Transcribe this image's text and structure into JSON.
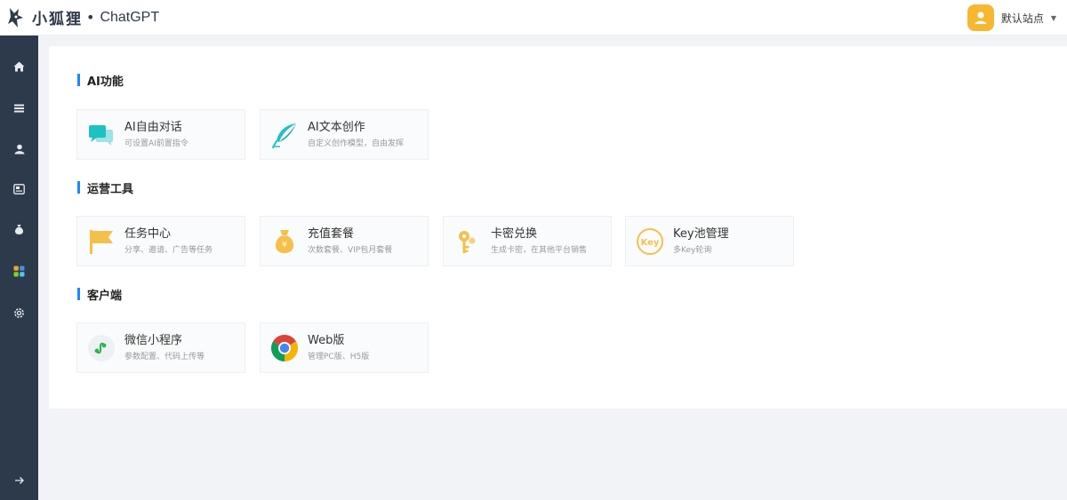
{
  "header": {
    "brand_cn": "小狐狸",
    "brand_dot": "•",
    "brand_en": "ChatGPT",
    "user_label": "默认站点",
    "caret": "▼"
  },
  "sidebar": {
    "items": [
      {
        "icon": "home-icon"
      },
      {
        "icon": "list-icon"
      },
      {
        "icon": "user-icon"
      },
      {
        "icon": "media-icon"
      },
      {
        "icon": "money-bag-icon"
      },
      {
        "icon": "apps-icon",
        "active": true
      },
      {
        "icon": "gear-icon"
      }
    ],
    "collapse_icon": "arrow-right-icon"
  },
  "sections": [
    {
      "title": "AI功能",
      "cards": [
        {
          "title": "AI自由对话",
          "desc": "可设置AI前置指令",
          "icon": "chat-bubbles-icon"
        },
        {
          "title": "AI文本创作",
          "desc": "自定义创作模型，自由发挥",
          "icon": "feather-icon"
        }
      ]
    },
    {
      "title": "运营工具",
      "cards": [
        {
          "title": "任务中心",
          "desc": "分享、邀请、广告等任务",
          "icon": "flag-icon"
        },
        {
          "title": "充值套餐",
          "desc": "次数套餐、VIP包月套餐",
          "icon": "money-bag-icon"
        },
        {
          "title": "卡密兑换",
          "desc": "生成卡密，在其他平台销售",
          "icon": "keys-icon"
        },
        {
          "title": "Key池管理",
          "desc": "多Key轮询",
          "icon": "key-circle-icon",
          "icon_text": "Key"
        }
      ]
    },
    {
      "title": "客户端",
      "cards": [
        {
          "title": "微信小程序",
          "desc": "参数配置、代码上传等",
          "icon": "miniprogram-icon"
        },
        {
          "title": "Web版",
          "desc": "管理PC版、H5版",
          "icon": "chrome-icon"
        }
      ]
    }
  ],
  "colors": {
    "sidebar_bg": "#2d3a4b",
    "accent": "#1a89ff",
    "avatar": "#f7b731",
    "chat_icon": "#1dc1c4",
    "gold_icon": "#f5c04a"
  }
}
